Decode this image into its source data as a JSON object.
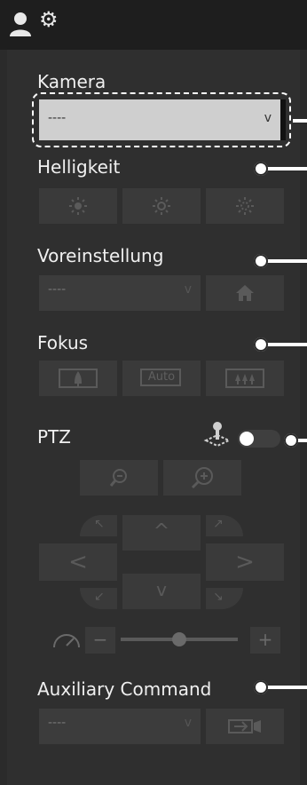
{
  "header": {
    "title": "",
    "user_icon": "user-icon",
    "settings_icon": "gear-icon"
  },
  "camera": {
    "label": "Kamera",
    "value": "----",
    "chevron": "v"
  },
  "brightness": {
    "label": "Helligkeit",
    "buttons": [
      "brightness-low-icon",
      "brightness-medium-icon",
      "brightness-high-icon"
    ]
  },
  "preset": {
    "label": "Voreinstellung",
    "value": "----",
    "chevron": "v",
    "home_icon": "home-icon"
  },
  "focus": {
    "label": "Fokus",
    "near_icon": "focus-near-icon",
    "auto_label": "Auto",
    "far_icon": "focus-far-icon"
  },
  "ptz": {
    "label": "PTZ",
    "joystick_icon": "joystick-icon",
    "toggle_state": "on",
    "zoom_out_icon": "zoom-out-icon",
    "zoom_in_icon": "zoom-in-icon",
    "up": "^",
    "down": "v",
    "left": "<",
    "right": ">",
    "speed_icon": "speed-gauge-icon",
    "speed_minus": "−",
    "speed_plus": "+",
    "speed_fraction": 0.5
  },
  "auxiliary": {
    "label": "Auxiliary Command",
    "value": "----",
    "chevron": "v",
    "send_icon": "send-command-icon"
  },
  "colors": {
    "background": "#2b2b2b",
    "panel": "#2f2f2f",
    "button": "#3a3a3a",
    "callout": "#ffffff"
  }
}
